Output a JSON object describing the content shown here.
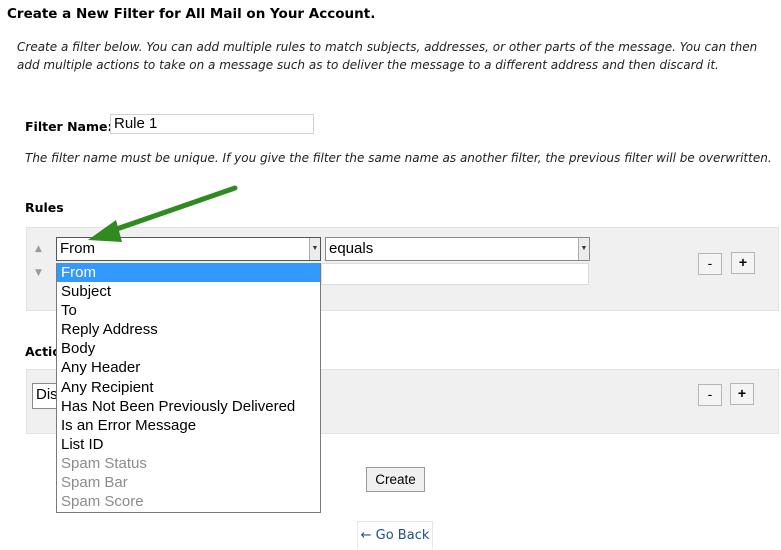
{
  "page": {
    "title": "Create a New Filter for All Mail on Your Account.",
    "description": "Create a filter below. You can add multiple rules to match subjects, addresses, or other parts of the message. You can then add multiple actions to take on a message such as to deliver the message to a different address and then discard it."
  },
  "filter_name": {
    "label": "Filter Name:",
    "value": "Rule 1",
    "note": "The filter name must be unique. If you give the filter the same name as another filter, the previous filter will be overwritten."
  },
  "rules": {
    "heading": "Rules",
    "field_select_value": "From",
    "operator_select_value": "equals",
    "value_input": "",
    "remove_label": "-",
    "add_label": "+",
    "move_up_icon": "triangle-up",
    "move_down_icon": "triangle-down"
  },
  "field_options": [
    {
      "label": "From",
      "state": "selected"
    },
    {
      "label": "Subject",
      "state": "normal"
    },
    {
      "label": "To",
      "state": "normal"
    },
    {
      "label": "Reply Address",
      "state": "normal"
    },
    {
      "label": "Body",
      "state": "normal"
    },
    {
      "label": "Any Header",
      "state": "normal"
    },
    {
      "label": "Any Recipient",
      "state": "normal"
    },
    {
      "label": "Has Not Been Previously Delivered",
      "state": "normal"
    },
    {
      "label": "Is an Error Message",
      "state": "normal"
    },
    {
      "label": "List ID",
      "state": "normal"
    },
    {
      "label": "Spam Status",
      "state": "disabled"
    },
    {
      "label": "Spam Bar",
      "state": "disabled"
    },
    {
      "label": "Spam Score",
      "state": "disabled"
    }
  ],
  "actions": {
    "heading": "Actio",
    "action_select_value": "Dis",
    "remove_label": "-",
    "add_label": "+"
  },
  "buttons": {
    "create": "Create",
    "go_back": "← Go Back"
  },
  "colors": {
    "annotation_arrow": "#2f8a1f",
    "selection_highlight": "#3399ff",
    "panel_background": "#f0f0f0",
    "link": "#1f4f8f"
  }
}
